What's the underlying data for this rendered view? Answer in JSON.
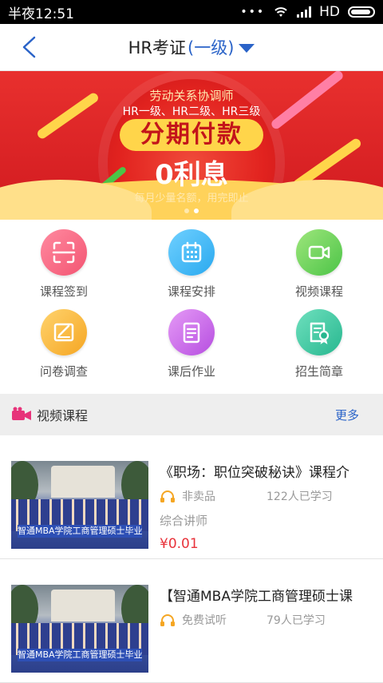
{
  "status_bar": {
    "time": "半夜12:51",
    "network": "HD"
  },
  "header": {
    "title": "HR考证",
    "level": "(一级)"
  },
  "banner": {
    "line1": "劳动关系协调师",
    "line2": "HR一级、HR二级、HR三级",
    "headline": "分期付款",
    "zero_interest": "0利息",
    "footer": "每月少量名额，用完即止",
    "active_dot": 1
  },
  "grid": [
    {
      "label": "课程签到",
      "icon": "scan-icon"
    },
    {
      "label": "课程安排",
      "icon": "calendar-icon"
    },
    {
      "label": "视频课程",
      "icon": "video-camera-icon"
    },
    {
      "label": "问卷调查",
      "icon": "edit-form-icon"
    },
    {
      "label": "课后作业",
      "icon": "document-icon"
    },
    {
      "label": "招生简章",
      "icon": "certificate-icon"
    }
  ],
  "section": {
    "title": "视频课程",
    "more": "更多",
    "icon": "video-icon"
  },
  "courses": [
    {
      "title": "《职场：职位突破秘诀》课程介",
      "tag": "非卖品",
      "learners": "122人已学习",
      "teacher": "综合讲师",
      "price": "¥0.01",
      "thumb_caption": "智通MBA学院工商管理硕士毕业典礼"
    },
    {
      "title": "【智通MBA学院工商管理硕士课",
      "tag": "免费试听",
      "learners": "79人已学习",
      "thumb_caption": "智通MBA学院工商管理硕士毕业典礼"
    }
  ],
  "colors": {
    "accent": "#2a63c8",
    "price": "#e8323a",
    "banner": "#d11a1f"
  }
}
